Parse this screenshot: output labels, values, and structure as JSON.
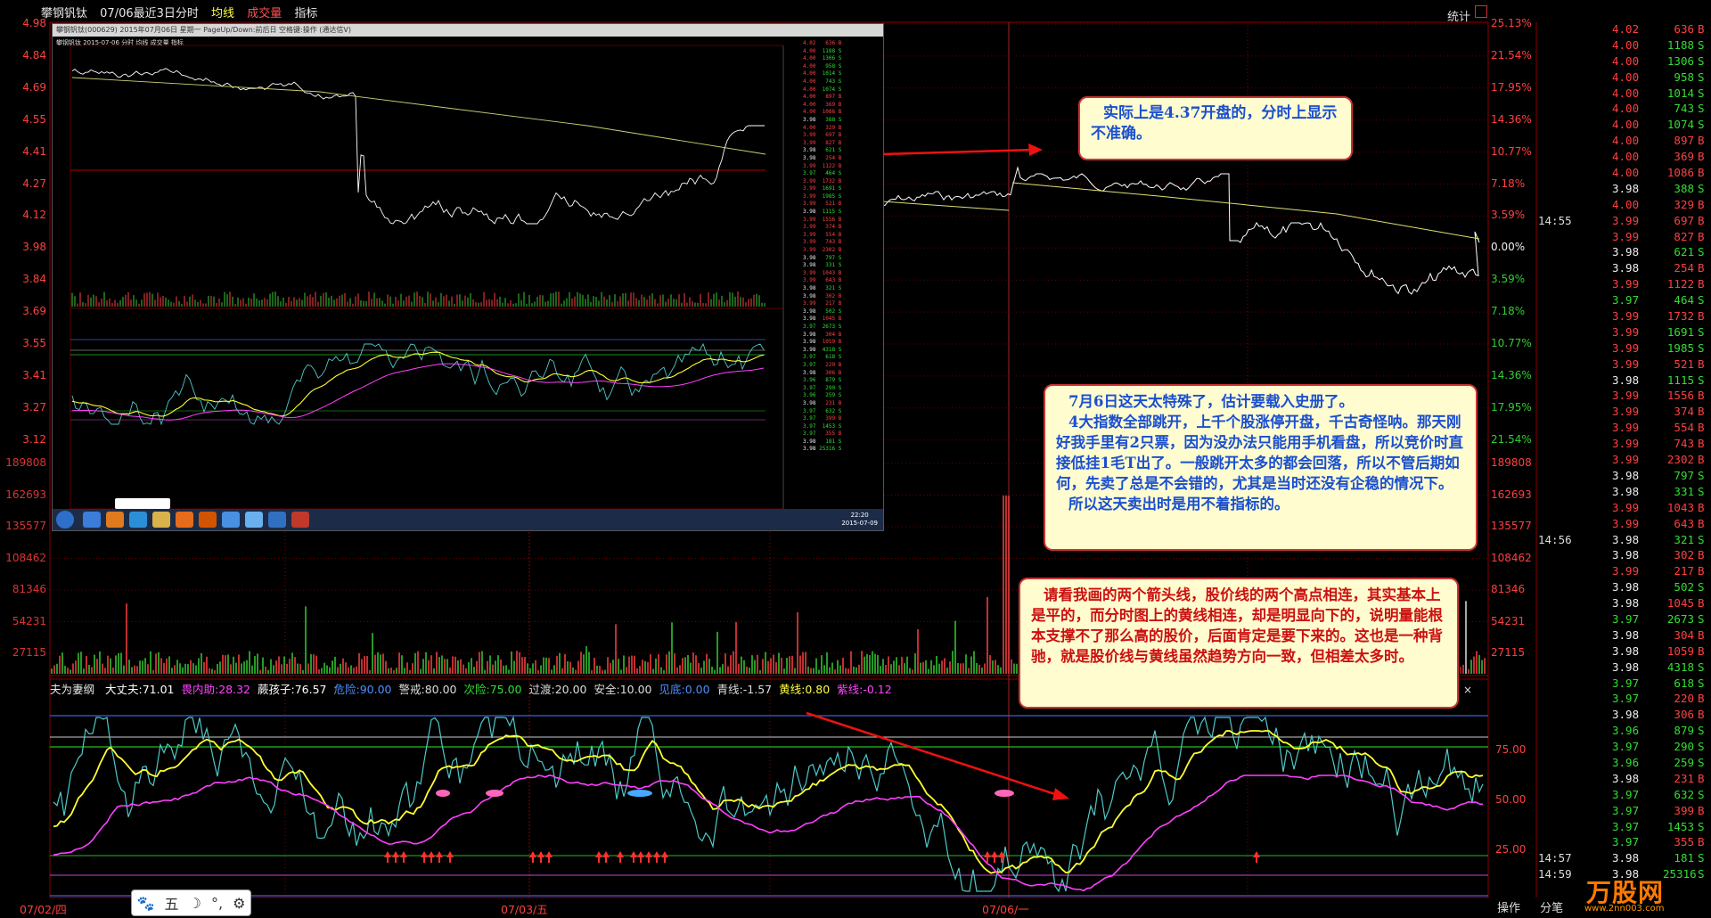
{
  "title_bar": {
    "stock_name": "攀钢钒钛",
    "chart_title": "07/06最近3日分时",
    "avg_line_label": "均线",
    "volume_label": "成交量",
    "indicator_label": "指标",
    "stat_button": "统计"
  },
  "price_axis_left": [
    "4.98",
    "4.84",
    "4.69",
    "4.55",
    "4.41",
    "4.27",
    "4.12",
    "3.98",
    "3.84",
    "3.69",
    "3.55",
    "3.41",
    "3.27",
    "3.12"
  ],
  "pct_axis_right": [
    "25.13%",
    "21.54%",
    "17.95%",
    "14.36%",
    "10.77%",
    "7.18%",
    "3.59%",
    "0.00%",
    "3.59%",
    "7.18%",
    "10.77%",
    "14.36%",
    "17.95%",
    "21.54%"
  ],
  "volume_axis_left": [
    "189808",
    "162693",
    "135577",
    "108462",
    "81346",
    "54231",
    "27115"
  ],
  "volume_axis_right": [
    "189808",
    "162693",
    "135577",
    "108462",
    "81346",
    "54231",
    "27115"
  ],
  "indicator_axis_right": [
    "75.00",
    "50.00",
    "25.00"
  ],
  "indicator_line": {
    "name": "夫为妻纲",
    "items": [
      {
        "label": "大丈夫:",
        "value": "71.01",
        "color": "#ffffff"
      },
      {
        "label": "畏内助:",
        "value": "28.32",
        "color": "#ff44ff"
      },
      {
        "label": "蕨孩子:",
        "value": "76.57",
        "color": "#ffffff"
      },
      {
        "label": "危险:",
        "value": "90.00",
        "color": "#4f8fff"
      },
      {
        "label": "警戒:",
        "value": "80.00",
        "color": "#dddddd"
      },
      {
        "label": "次险:",
        "value": "75.00",
        "color": "#33dd33"
      },
      {
        "label": "过渡:",
        "value": "20.00",
        "color": "#dddddd"
      },
      {
        "label": "安全:",
        "value": "10.00",
        "color": "#dddddd"
      },
      {
        "label": "见底:",
        "value": "0.00",
        "color": "#4f8fff"
      },
      {
        "label": "青线:",
        "value": "-1.57",
        "color": "#dddddd"
      },
      {
        "label": "黄线:",
        "value": "0.80",
        "color": "#ffff44"
      },
      {
        "label": "紫线:",
        "value": "-0.12",
        "color": "#ff44ff"
      }
    ]
  },
  "date_axis": [
    "07/02/四",
    "07/03/五",
    "07/06/一"
  ],
  "tick_list": [
    {
      "time": "",
      "price": "4.02",
      "vol": "636",
      "dir": "B",
      "pc": "red",
      "dc": "red"
    },
    {
      "time": "",
      "price": "4.00",
      "vol": "1188",
      "dir": "S",
      "pc": "red",
      "dc": "green"
    },
    {
      "time": "",
      "price": "4.00",
      "vol": "1306",
      "dir": "S",
      "pc": "red",
      "dc": "green"
    },
    {
      "time": "",
      "price": "4.00",
      "vol": "958",
      "dir": "S",
      "pc": "red",
      "dc": "green"
    },
    {
      "time": "",
      "price": "4.00",
      "vol": "1014",
      "dir": "S",
      "pc": "red",
      "dc": "green"
    },
    {
      "time": "",
      "price": "4.00",
      "vol": "743",
      "dir": "S",
      "pc": "red",
      "dc": "green"
    },
    {
      "time": "",
      "price": "4.00",
      "vol": "1074",
      "dir": "S",
      "pc": "red",
      "dc": "green"
    },
    {
      "time": "",
      "price": "4.00",
      "vol": "897",
      "dir": "B",
      "pc": "red",
      "dc": "red"
    },
    {
      "time": "",
      "price": "4.00",
      "vol": "369",
      "dir": "B",
      "pc": "red",
      "dc": "red"
    },
    {
      "time": "",
      "price": "4.00",
      "vol": "1086",
      "dir": "B",
      "pc": "red",
      "dc": "red"
    },
    {
      "time": "",
      "price": "3.98",
      "vol": "388",
      "dir": "S",
      "pc": "white",
      "dc": "green"
    },
    {
      "time": "",
      "price": "4.00",
      "vol": "329",
      "dir": "B",
      "pc": "red",
      "dc": "red"
    },
    {
      "time": "14:55",
      "price": "3.99",
      "vol": "697",
      "dir": "B",
      "pc": "red",
      "dc": "red"
    },
    {
      "time": "",
      "price": "3.99",
      "vol": "827",
      "dir": "B",
      "pc": "red",
      "dc": "red"
    },
    {
      "time": "",
      "price": "3.98",
      "vol": "621",
      "dir": "S",
      "pc": "white",
      "dc": "green"
    },
    {
      "time": "",
      "price": "3.98",
      "vol": "254",
      "dir": "B",
      "pc": "white",
      "dc": "red"
    },
    {
      "time": "",
      "price": "3.99",
      "vol": "1122",
      "dir": "B",
      "pc": "red",
      "dc": "red"
    },
    {
      "time": "",
      "price": "3.97",
      "vol": "464",
      "dir": "S",
      "pc": "green",
      "dc": "green"
    },
    {
      "time": "",
      "price": "3.99",
      "vol": "1732",
      "dir": "B",
      "pc": "red",
      "dc": "red"
    },
    {
      "time": "",
      "price": "3.99",
      "vol": "1691",
      "dir": "S",
      "pc": "red",
      "dc": "green"
    },
    {
      "time": "",
      "price": "3.99",
      "vol": "1985",
      "dir": "S",
      "pc": "red",
      "dc": "green"
    },
    {
      "time": "",
      "price": "3.99",
      "vol": "521",
      "dir": "B",
      "pc": "red",
      "dc": "red"
    },
    {
      "time": "",
      "price": "3.98",
      "vol": "1115",
      "dir": "S",
      "pc": "white",
      "dc": "green"
    },
    {
      "time": "",
      "price": "3.99",
      "vol": "1556",
      "dir": "B",
      "pc": "red",
      "dc": "red"
    },
    {
      "time": "",
      "price": "3.99",
      "vol": "374",
      "dir": "B",
      "pc": "red",
      "dc": "red"
    },
    {
      "time": "",
      "price": "3.99",
      "vol": "554",
      "dir": "B",
      "pc": "red",
      "dc": "red"
    },
    {
      "time": "",
      "price": "3.99",
      "vol": "743",
      "dir": "B",
      "pc": "red",
      "dc": "red"
    },
    {
      "time": "",
      "price": "3.99",
      "vol": "2302",
      "dir": "B",
      "pc": "red",
      "dc": "red"
    },
    {
      "time": "",
      "price": "3.98",
      "vol": "797",
      "dir": "S",
      "pc": "white",
      "dc": "green"
    },
    {
      "time": "",
      "price": "3.98",
      "vol": "331",
      "dir": "S",
      "pc": "white",
      "dc": "green"
    },
    {
      "time": "",
      "price": "3.99",
      "vol": "1043",
      "dir": "B",
      "pc": "red",
      "dc": "red"
    },
    {
      "time": "",
      "price": "3.99",
      "vol": "643",
      "dir": "B",
      "pc": "red",
      "dc": "red"
    },
    {
      "time": "14:56",
      "price": "3.98",
      "vol": "321",
      "dir": "S",
      "pc": "white",
      "dc": "green"
    },
    {
      "time": "",
      "price": "3.98",
      "vol": "302",
      "dir": "B",
      "pc": "white",
      "dc": "red"
    },
    {
      "time": "",
      "price": "3.99",
      "vol": "217",
      "dir": "B",
      "pc": "red",
      "dc": "red"
    },
    {
      "time": "",
      "price": "3.98",
      "vol": "502",
      "dir": "S",
      "pc": "white",
      "dc": "green"
    },
    {
      "time": "",
      "price": "3.98",
      "vol": "1045",
      "dir": "B",
      "pc": "white",
      "dc": "red"
    },
    {
      "time": "",
      "price": "3.97",
      "vol": "2673",
      "dir": "S",
      "pc": "green",
      "dc": "green"
    },
    {
      "time": "",
      "price": "3.98",
      "vol": "304",
      "dir": "B",
      "pc": "white",
      "dc": "red"
    },
    {
      "time": "",
      "price": "3.98",
      "vol": "1059",
      "dir": "B",
      "pc": "white",
      "dc": "red"
    },
    {
      "time": "",
      "price": "3.98",
      "vol": "4318",
      "dir": "S",
      "pc": "white",
      "dc": "green"
    },
    {
      "time": "",
      "price": "3.97",
      "vol": "618",
      "dir": "S",
      "pc": "green",
      "dc": "green"
    },
    {
      "time": "",
      "price": "3.97",
      "vol": "220",
      "dir": "B",
      "pc": "green",
      "dc": "red"
    },
    {
      "time": "",
      "price": "3.98",
      "vol": "306",
      "dir": "B",
      "pc": "white",
      "dc": "red"
    },
    {
      "time": "",
      "price": "3.96",
      "vol": "879",
      "dir": "S",
      "pc": "green",
      "dc": "green"
    },
    {
      "time": "",
      "price": "3.97",
      "vol": "290",
      "dir": "S",
      "pc": "green",
      "dc": "green"
    },
    {
      "time": "",
      "price": "3.96",
      "vol": "259",
      "dir": "S",
      "pc": "green",
      "dc": "green"
    },
    {
      "time": "",
      "price": "3.98",
      "vol": "231",
      "dir": "B",
      "pc": "white",
      "dc": "red"
    },
    {
      "time": "",
      "price": "3.97",
      "vol": "632",
      "dir": "S",
      "pc": "green",
      "dc": "green"
    },
    {
      "time": "",
      "price": "3.97",
      "vol": "399",
      "dir": "B",
      "pc": "green",
      "dc": "red"
    },
    {
      "time": "",
      "price": "3.97",
      "vol": "1453",
      "dir": "S",
      "pc": "green",
      "dc": "green"
    },
    {
      "time": "",
      "price": "3.97",
      "vol": "355",
      "dir": "B",
      "pc": "green",
      "dc": "red"
    },
    {
      "time": "14:57",
      "price": "3.98",
      "vol": "181",
      "dir": "S",
      "pc": "white",
      "dc": "green"
    },
    {
      "time": "14:59",
      "price": "3.98",
      "vol": "25316",
      "dir": "S",
      "pc": "white",
      "dc": "green"
    }
  ],
  "notes": {
    "note1": "实际上是4.37开盘的，分时上显示不准确。",
    "note2": [
      "7月6日这天太特殊了，估计要载入史册了。",
      "4大指数全部跳开，上千个股涨停开盘，千古奇怪呐。那天刚好我手里有2只票，因为没办法只能用手机看盘，所以竞价时直接低挂1毛T出了。一般跳开太多的都会回落，所以不管后期如何，先卖了总是不会错的，尤其是当时还没有企稳的情况下。",
      "所以这天卖出时是用不着指标的。"
    ],
    "note3": "请看我画的两个箭头线，股价线的两个高点相连，其实基本上是平的，而分时图上的黄线相连，却是明显向下的，说明量能根本支撑不了那么高的股价，后面肯定是要下来的。这也是一种背驰，就是股价线与黄线虽然趋势方向一致，但相差太多时。"
  },
  "embedded_window": {
    "title": "攀钢钒钛(000629) 2015年07月06日 星期一 PageUp/Down:前后日 空格键:操作 (通达信V)",
    "header": "攀钢钒钛  2015-07-06 分时 均线 成交量 指标",
    "clock_time": "22:20",
    "clock_date": "2015-07-09"
  },
  "toolbar_float": [
    "🐾",
    "五",
    "☽",
    "°,",
    "⚙"
  ],
  "bottom_right": {
    "ops": "操作",
    "split": "分笔"
  },
  "watermark": {
    "text": "万股网",
    "url": "www.2nn003.com"
  },
  "colors": {
    "price_line": "#ffffff",
    "avg_line": "#ffff55",
    "grid_red": "#8b0000",
    "cyan": "#4fc9c9",
    "yellow": "#ffff30",
    "magenta": "#ff40ff"
  }
}
